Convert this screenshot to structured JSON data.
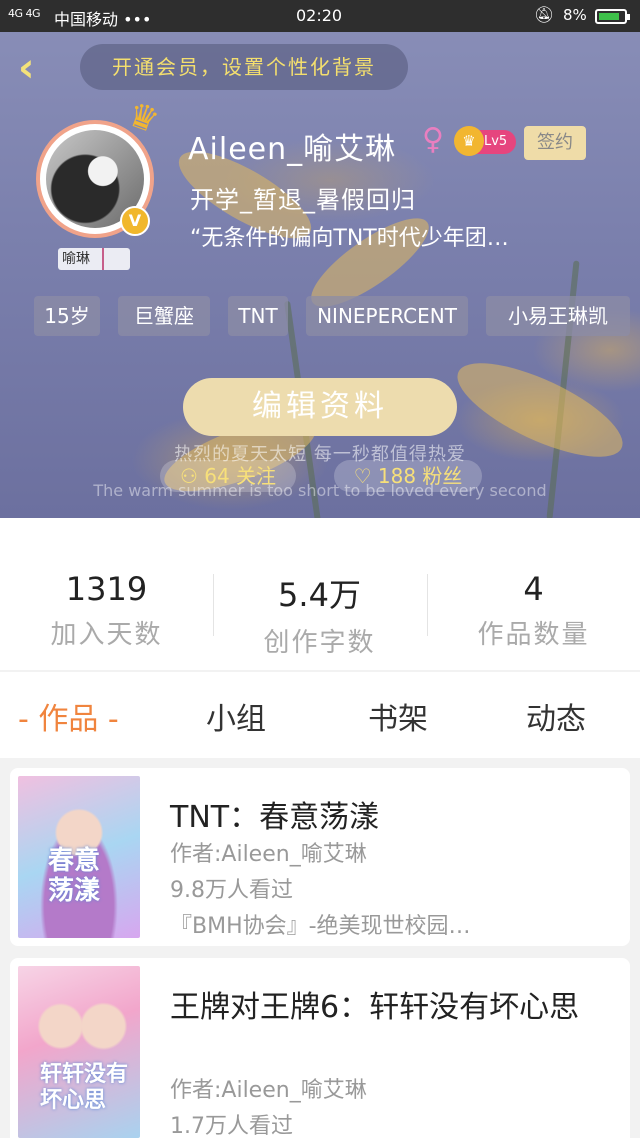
{
  "status_bar": {
    "signal": "4G 4G",
    "carrier": "中国移动 •••",
    "time": "02:20",
    "battery": "8%"
  },
  "header": {
    "vip_promo": "开通会员，设置个性化背景",
    "avatar_tag": "喻琳",
    "username": "Aileen_喻艾琳",
    "gender_symbol": "♀",
    "level": "Lv5",
    "sign_label": "签约",
    "bio_line1": "开学_暂退_暑假回归",
    "bio_line2": "“无条件的偏向TNT时代少年团…",
    "tags": [
      "15岁",
      "巨蟹座",
      "TNT",
      "NINEPERCENT",
      "小易王琳凯"
    ],
    "edit_label": "编辑资料",
    "quote_cn": "热烈的夏天太短 每一秒都值得热爱",
    "quote_en": "The warm summer is too short to be loved every second",
    "follow": "64 关注",
    "fans": "188 粉丝"
  },
  "stats": [
    {
      "value": "1319",
      "label": "加入天数"
    },
    {
      "value": "5.4万",
      "label": "创作字数"
    },
    {
      "value": "4",
      "label": "作品数量"
    }
  ],
  "tabs": [
    "- 作品 -",
    "小组",
    "书架",
    "动态"
  ],
  "works": [
    {
      "title": "TNT：春意荡漾",
      "author": "作者:Aileen_喻艾琳",
      "views": "9.8万人看过",
      "desc": "『BMH协会』-绝美现世校园…",
      "cover_text": "春意荡漾"
    },
    {
      "title": "王牌对王牌6：轩轩没有坏心思",
      "author": "作者:Aileen_喻艾琳",
      "views": "1.7万人看过",
      "cover_text": "轩轩没有坏心思"
    }
  ],
  "colors": {
    "accent": "#f0843e",
    "gold_text": "#f4df6e",
    "level_badge": "#e6457e"
  }
}
